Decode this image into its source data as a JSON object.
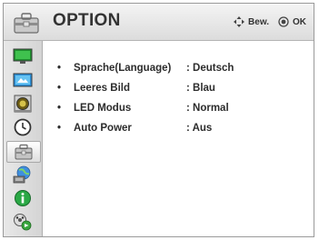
{
  "header": {
    "title": "OPTION",
    "hint_move": "Bew.",
    "hint_ok": "OK",
    "icon": "toolbox-icon"
  },
  "sidebar": {
    "items": [
      {
        "name": "picture-icon",
        "active": false
      },
      {
        "name": "screen-icon",
        "active": false
      },
      {
        "name": "audio-icon",
        "active": false
      },
      {
        "name": "clock-icon",
        "active": false
      },
      {
        "name": "option-icon",
        "active": true
      },
      {
        "name": "network-icon",
        "active": false
      },
      {
        "name": "info-icon",
        "active": false
      },
      {
        "name": "media-icon",
        "active": false
      }
    ]
  },
  "settings": [
    {
      "bullet": "•",
      "label": "Sprache(Language)",
      "value": ": Deutsch"
    },
    {
      "bullet": "•",
      "label": "Leeres Bild",
      "value": ": Blau"
    },
    {
      "bullet": "•",
      "label": "LED Modus",
      "value": ": Normal"
    },
    {
      "bullet": "•",
      "label": "Auto Power",
      "value": ": Aus"
    }
  ],
  "colors": {
    "header_gradient_top": "#f4f4f4",
    "header_gradient_bottom": "#dcdcdc",
    "sidebar": "#dcdcdc",
    "text": "#2c2c2c"
  }
}
